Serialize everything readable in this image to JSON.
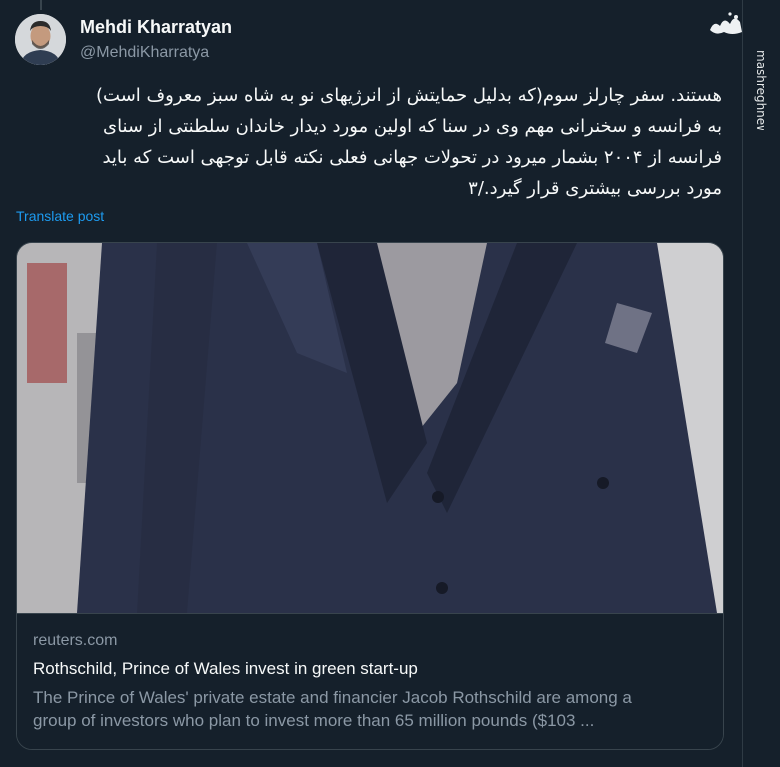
{
  "author": {
    "display_name": "Mehdi Kharratyan",
    "handle": "@MehdiKharratya"
  },
  "tweet": {
    "lines": [
      "هستند. سفر چارلز سوم(که بدلیل حمایتش از انرژیهای نو به شاه سبز معروف است)",
      "به فرانسه و سخنرانی مهم وی در سنا که اولین مورد دیدار خاندان سلطنتی از سنای",
      "فرانسه از ۲۰۰۴ بشمار میرود در تحولات جهانی فعلی نکته قابل توجهی است که باید",
      "مورد بررسی بیشتری قرار گیرد./۳"
    ],
    "translate_label": "Translate post"
  },
  "card": {
    "domain": "reuters.com",
    "title": "Rothschild, Prince of Wales invest in green start-up",
    "description_lines": [
      "The Prince of Wales' private estate and financier Jacob Rothschild are among a",
      "group of investors who plan to invest more than 65 million pounds ($103 ..."
    ]
  },
  "watermark": {
    "logo_text": "مشرق",
    "site": "mashreghnews.ir"
  },
  "colors": {
    "background": "#15202b",
    "text": "#f7f9f9",
    "muted": "#8b98a5",
    "link": "#1d9bf0",
    "border": "#38444d"
  }
}
